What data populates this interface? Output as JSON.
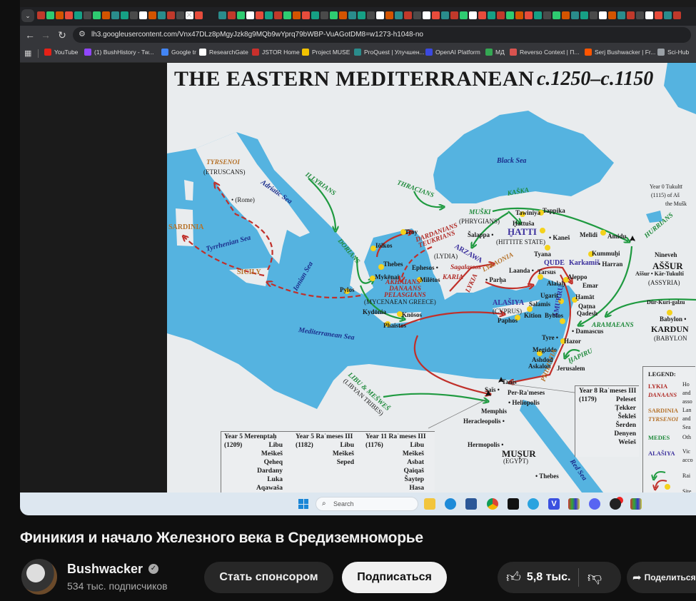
{
  "browser": {
    "url": "lh3.googleusercontent.com/Vnx47DLz8pMgyJzk8g9MQb9wYprq79bWBP-VuAGotDM8=w1273-h1048-no",
    "bookmarks": [
      "YouTube",
      "(1) BushHistory - Tw...",
      "Google tr",
      "ResearchGate",
      "JSTOR Home",
      "Project MUSE",
      "ProQuest | Улучшен...",
      "OpenAI Platform",
      "МД",
      "Reverso Context | П...",
      "Serj Bushwacker | Fr...",
      "Sci-Hub"
    ],
    "bookmark_colors": [
      "#e62117",
      "#9146ff",
      "#4285f4",
      "#ffffff",
      "#c9302c",
      "#f2c200",
      "#2a8c8c",
      "#3b49df",
      "#34a853",
      "#d9534f",
      "#ff5500",
      "#9aa0a6"
    ]
  },
  "map": {
    "labels": {
      "title": "THE EASTERN MEDITERRANEAN",
      "dates": "c.1250–c.1150",
      "tyrsenoi": "TYRSENOI",
      "etruscans": "(ETRUSCANS)",
      "rome": "• (Rome)",
      "adriatic": "Adriatic Sea",
      "illyrians": "ILLYRIANS",
      "thracians": "THRACIANS",
      "blacksea": "Black Sea",
      "kaska": "KAŠKA",
      "tuk1": "Year 0 Tukultī",
      "tuk2": "(1115)    of Aš",
      "tuk3": "the Mušk",
      "sardinia": "SARDINIA",
      "tyrrhenian": "Tyrrhenian Sea",
      "sicily": "SICILY",
      "ionian": "Ionian Sea",
      "dorians": "DORIANS",
      "iolkos": "Iōlkos",
      "thebes": "Thebes",
      "mykenai": "Mykēnai",
      "pylos": "Pylos",
      "akhaians": "AKHAIANS",
      "danaans": "DANAANS",
      "pelasgians": "PELASGIANS",
      "mycgreece": "(MYCENAEAN GREECE)",
      "troy": "Troy",
      "dardanians": "DARDANIANS",
      "teukrians": "TEUKRIANS",
      "lydia": "(LYDIA)",
      "arzawa": "ARZAWA",
      "ephesos": "Ephesos •",
      "miletos": "Milētos",
      "karia": "KARIA",
      "sagalassos": "Sagalassos",
      "lykia": "LYKIA",
      "lykaonia": "LYKAONIA",
      "parha": "• Parḫa",
      "salappa": "Šalappa •",
      "muski": "MUŠKI",
      "phrygians": "(PHRYGIANS)",
      "tawiniya": "Tawiniya",
      "tappika": "Tappika",
      "hattusa": "Ḫattuša",
      "hatti": "ḪATTI",
      "hittite": "(HITTITE STATE)",
      "kanes": "• Kaneš",
      "melidi": "Melīdi",
      "amidu": "Amidu",
      "hurrians": "HURRIANS",
      "tyana": "Tyana",
      "kummuhi": "Kummuḫi",
      "nineveh": "Nineveh",
      "assur": "AŠŠUR",
      "assurcity": "Aššur • Kār-Tukultī",
      "assyria": "(ASSYRIA)",
      "qude": "QUDE",
      "karkamis": "Karkamiš",
      "harran": "• Harran",
      "laanda": "Laanda •",
      "tarsus": "Tarsus",
      "alalah": "Alalaḫ",
      "aleppo": "Aleppo",
      "emar": "Emar",
      "amurru": "AMURRU",
      "ugarit": "Ugarit",
      "hamat": "Ḫamāt",
      "qatna": "Qaṭna",
      "qadesh": "Qadesh",
      "salamis": "Salamis",
      "alasiya": "ALAŠIYA",
      "cyprus": "(CYPRUS)",
      "kition": "Kition",
      "paphos": "Paphos",
      "byblos": "Byblos",
      "durkuri": "Dūr-Kuri-galzu",
      "babylon": "Babylon •",
      "kardun": "KARDUN",
      "babylonia": "(BABYLON",
      "aramaeans": "ARAMAEANS",
      "damascus": "• Damascus",
      "tyre": "Tyre •",
      "hazor": "Hazor",
      "megiddo": "Megiddo",
      "hapiru": "ḪAPIRU",
      "philistia": "PHILISTIA",
      "ashdod": "Ashdod",
      "askalon": "Askalon",
      "jerusalem": "Jerusalem",
      "kydonia": "Kydōnia",
      "knosos": "Knōsos",
      "phaistos": "Phaistos",
      "medsea": "Mediterranean Sea",
      "libu": "LIBU & MEŠWEŠ",
      "libyan": "(LIBYAN TRIBES)",
      "tanis": "Tanis",
      "sais": "Saïs •",
      "perrameses": "Per-Ra'meses",
      "heliopolis": "• Heliopolis",
      "memphis": "Memphis",
      "heracleopolis": "Heracleopolis •",
      "hermopolis": "Hermopolis •",
      "musur": "MUṢUR",
      "egypt": "(EGYPT)",
      "thebesegypt": "• Thebes",
      "redsea": "Red Sea"
    },
    "raid_boxes": [
      {
        "title": "Year 5 Merenptaḥ",
        "year": "(1209)",
        "peoples": [
          "Libu",
          "Meškeš",
          "Qeheq",
          "Dardany",
          "Luka",
          "Aqawaša"
        ]
      },
      {
        "title": "Year 5 Raʿmeses III",
        "year": "(1182)",
        "peoples": [
          "Libu",
          "Meškeš",
          "Seped"
        ]
      },
      {
        "title": "Year 11 Raʿmeses III",
        "year": "(1176)",
        "peoples": [
          "Libu",
          "Meškeš",
          "Asbat",
          "Qaiqaš",
          "Šaytep",
          "Hasa"
        ]
      },
      {
        "title": "Year 8 Raʿmeses III",
        "year": "(1179)",
        "peoples": [
          "Peleset",
          "Ṭekker",
          "Šekleš",
          "Šerden",
          "Denyen",
          "Wešeš"
        ]
      }
    ],
    "legend": {
      "title": "LEGEND:",
      "entries": [
        "LYKIA",
        "DANAANS",
        "SARDINIA",
        "TYRSENOI",
        "MEDES",
        "ALAŠIYA"
      ],
      "descriptions": [
        "Ho",
        "and",
        "asso",
        "Lan",
        "and",
        "Sea",
        "Oth",
        "Vic",
        "acco",
        "Rai",
        "Site"
      ]
    }
  },
  "taskbar": {
    "search_placeholder": "Search"
  },
  "video": {
    "title": "Финикия и начало Железного века в Средиземноморье",
    "channel": "Bushwacker",
    "subscribers": "534 тыс. подписчиков",
    "join_label": "Стать спонсором",
    "subscribe_label": "Подписаться",
    "likes": "5,8 тыс.",
    "share_label": "Поделиться"
  }
}
